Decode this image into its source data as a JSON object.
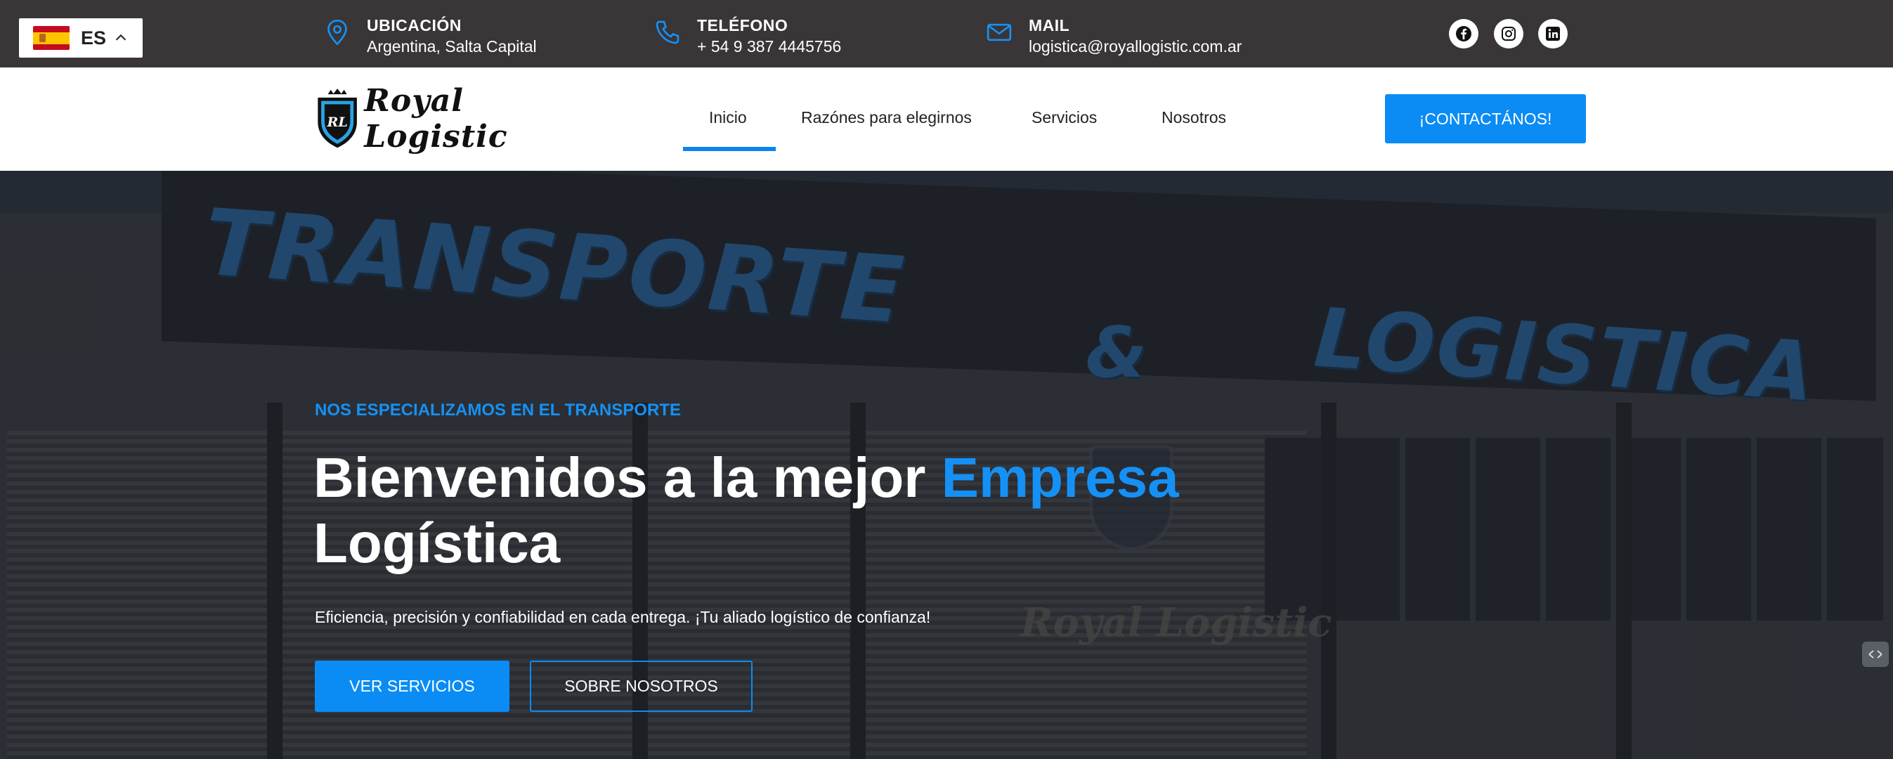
{
  "language": {
    "code": "ES",
    "icon": "spain-flag-icon"
  },
  "topbar": {
    "location": {
      "title": "UBICACIÓN",
      "value": "Argentina, Salta Capital",
      "icon": "map-pin-icon"
    },
    "phone": {
      "title": "TELÉFONO",
      "value": "+ 54 9 387 4445756",
      "icon": "phone-icon"
    },
    "mail": {
      "title": "MAIL",
      "value": "logistica@royallogistic.com.ar",
      "icon": "mail-icon"
    },
    "social": [
      "facebook-icon",
      "instagram-icon",
      "linkedin-icon"
    ]
  },
  "nav": {
    "logo_text": "Royal Logistic",
    "logo_monogram": "RL",
    "items": [
      {
        "label": "Inicio",
        "active": true
      },
      {
        "label": "Razónes para elegirnos"
      },
      {
        "label": "Servicios"
      },
      {
        "label": "Nosotros"
      }
    ],
    "cta": "¡CONTACTÁNOS!"
  },
  "hero": {
    "background_sign": {
      "word1": "TRANSPORTE",
      "amp": "&",
      "word2": "LOGISTICA",
      "emblem_text": "Royal Logistic"
    },
    "eyebrow": "NOS ESPECIALIZAMOS EN EL TRANSPORTE",
    "title_part1": "Bienvenidos a la mejor ",
    "title_accent": "Empresa",
    "title_part2": "Logística",
    "subtitle": "Eficiencia, precisión y confiabilidad en cada entrega. ¡Tu aliado logístico de confianza!",
    "buttons": {
      "primary": "VER SERVICIOS",
      "secondary": "SOBRE NOSOTROS"
    }
  },
  "colors": {
    "accent": "#0b8cf5",
    "topbar_bg": "#3a3536",
    "nav_bg": "#ffffff"
  }
}
